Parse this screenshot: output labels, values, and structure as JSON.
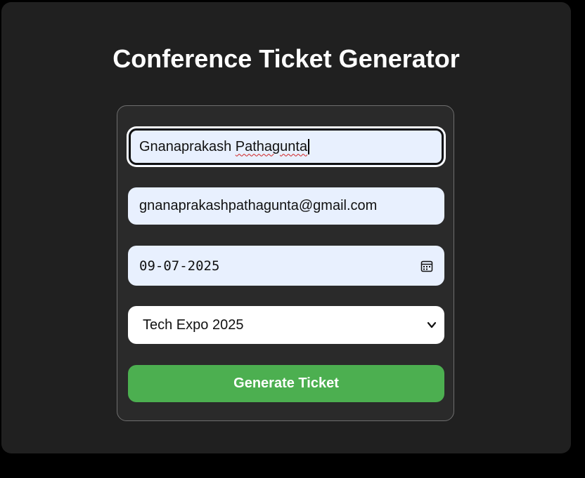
{
  "app": {
    "title": "Conference Ticket Generator"
  },
  "form": {
    "name": {
      "value_first": "Gnanaprakash",
      "value_last": "Pathagunta"
    },
    "email": {
      "value": "gnanaprakashpathagunta@gmail.com"
    },
    "date": {
      "value": "09-07-2025",
      "icon": "calendar-icon"
    },
    "event": {
      "selected": "Tech Expo 2025",
      "icon": "chevron-down-icon"
    },
    "submit_label": "Generate Ticket"
  },
  "colors": {
    "background": "#202020",
    "card": "#2a2a2a",
    "input_autofill": "#e8f0fe",
    "accent": "#4caf50",
    "text_light": "#ffffff"
  }
}
